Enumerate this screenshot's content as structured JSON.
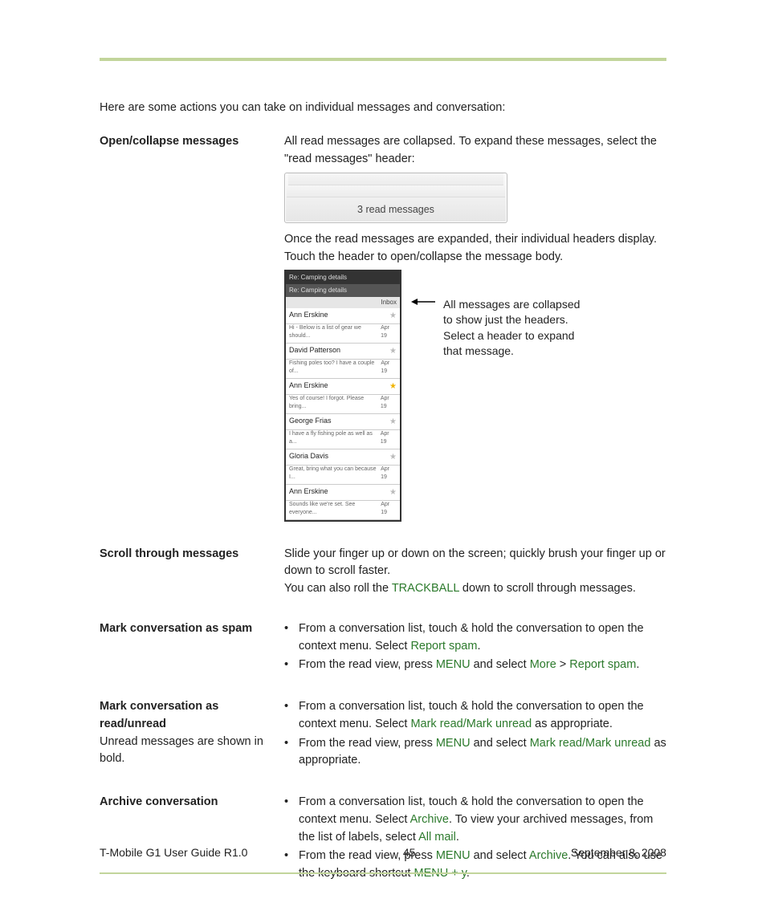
{
  "intro": "Here are some actions you can take on individual messages and conversation:",
  "sections": {
    "open": {
      "term": "Open/collapse messages",
      "p1": "All read messages are collapsed. To expand these messages, select the \"read messages\" header:",
      "shot1_label": "3 read messages",
      "p2": "Once the read messages are expanded, their individual headers display. Touch the header to open/collapse the message body.",
      "caption_l1": "All messages are collapsed",
      "caption_l2": "to show just the headers.",
      "caption_l3": "Select a header to expand",
      "caption_l4": "that message."
    },
    "shot2": {
      "hdr1": "Re: Camping details",
      "hdr2": "Re: Camping details",
      "inbox": "Inbox",
      "rows": [
        {
          "name": "Ann Erskine",
          "preview": "Hi - Below is a list of gear we should...",
          "date": "Apr 19",
          "star": "off"
        },
        {
          "name": "David Patterson",
          "preview": "Fishing poles too? I have a couple of...",
          "date": "Apr 19",
          "star": "off"
        },
        {
          "name": "Ann Erskine",
          "preview": "Yes of course! I forgot. Please bring...",
          "date": "Apr 19",
          "star": "on"
        },
        {
          "name": "George Frias",
          "preview": "I have a fly fishing pole as well as a...",
          "date": "Apr 19",
          "star": "off"
        },
        {
          "name": "Gloria Davis",
          "preview": "Great, bring what you can because I...",
          "date": "Apr 19",
          "star": "off"
        },
        {
          "name": "Ann Erskine",
          "preview": "Sounds like we're set. See everyone...",
          "date": "Apr 19",
          "star": "off"
        }
      ]
    },
    "scroll": {
      "term": "Scroll through messages",
      "p1": "Slide your finger up or down on the screen; quickly brush your finger up or down to scroll faster.",
      "p2a": "You can also roll the ",
      "trackball": "TRACKBALL",
      "p2b": " down to scroll through messages."
    },
    "spam": {
      "term": "Mark conversation as spam",
      "b1a": "From a conversation list, touch & hold the conversation to open the context menu. Select ",
      "b1h": "Report spam",
      "b1b": ".",
      "b2a": "From the read view, press ",
      "menu": "MENU",
      "b2b": " and select ",
      "more": "More",
      "gt": " > ",
      "b2h": "Report spam",
      "b2c": "."
    },
    "read": {
      "term": "Mark conversation as read/unread",
      "note": "Unread messages are shown in bold.",
      "b1a": "From a conversation list, touch & hold the conversation to open the context menu. Select ",
      "b1h": "Mark read/Mark unread",
      "b1b": " as appropriate.",
      "b2a": "From the read view, press ",
      "menu": "MENU",
      "b2b": " and select ",
      "b2h": "Mark read/Mark unread",
      "b2c": " as appropriate."
    },
    "archive": {
      "term": "Archive conversation",
      "b1a": "From a conversation list, touch & hold the conversation to open the context menu. Select ",
      "b1h1": "Archive",
      "b1b": ". To view your archived messages, from the list of labels, select ",
      "b1h2": "All mail",
      "b1c": ".",
      "b2a": "From the read view, press ",
      "menu": "MENU",
      "b2b": " and select ",
      "b2h1": "Archive",
      "b2c": ". You can also use the keyboard shortcut ",
      "b2h2": "MENU + y",
      "b2d": "."
    }
  },
  "footer": {
    "left": "T-Mobile G1 User Guide R1.0",
    "center": "45",
    "right": "September 8, 2008"
  }
}
